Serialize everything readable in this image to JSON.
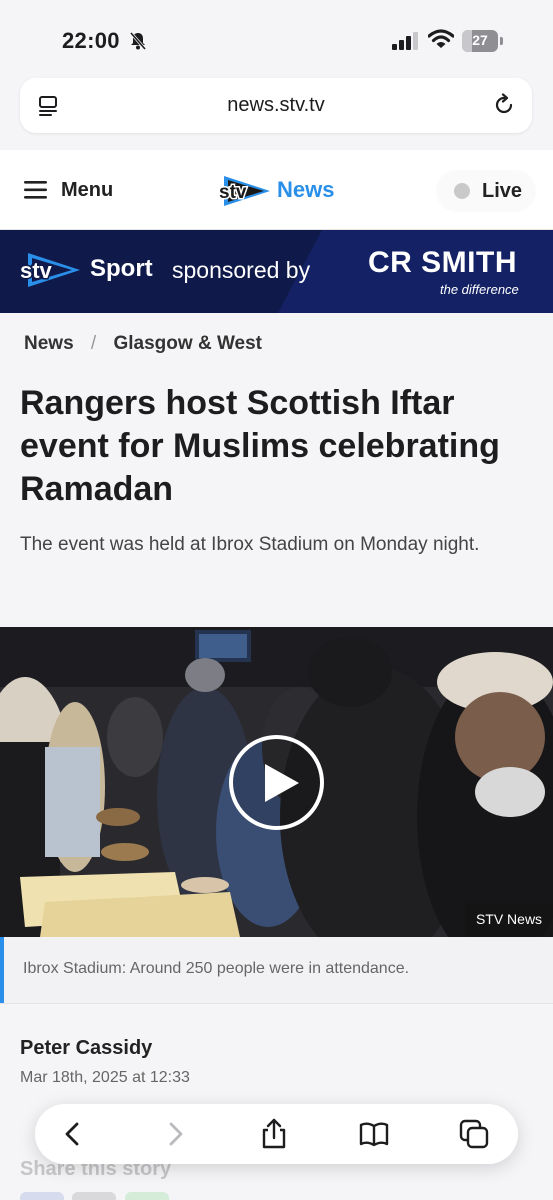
{
  "status": {
    "time": "22:00",
    "battery_level": "27",
    "battery_fraction": 0.27
  },
  "browser": {
    "url": "news.stv.tv",
    "icons": [
      "reader-icon",
      "reload-icon",
      "back-icon",
      "forward-icon",
      "share-icon",
      "bookmarks-icon",
      "tabs-icon"
    ]
  },
  "header": {
    "menu_label": "Menu",
    "logo_text": "stv",
    "news_label": "News",
    "live_label": "Live"
  },
  "banner": {
    "sport_label": "Sport",
    "sponsored_label": "sponsored by",
    "sponsor_name": "CR SMITH",
    "sponsor_tagline": "the difference"
  },
  "article": {
    "breadcrumb": [
      "News",
      "Glasgow & West"
    ],
    "headline": "Rangers host Scottish Iftar event for Muslims celebrating Ramadan",
    "standfirst": "The event was held at Ibrox Stadium on Monday night.",
    "video_source": "STV News",
    "caption": "Ibrox Stadium: Around 250 people were in attendance.",
    "author": "Peter Cassidy",
    "date": "Mar 18th, 2025 at 12:33",
    "share_label": "Share this story"
  },
  "colors": {
    "accent": "#2a8fe8",
    "banner_bg": "#0f1a4a",
    "page_bg": "#f5f5f7"
  }
}
